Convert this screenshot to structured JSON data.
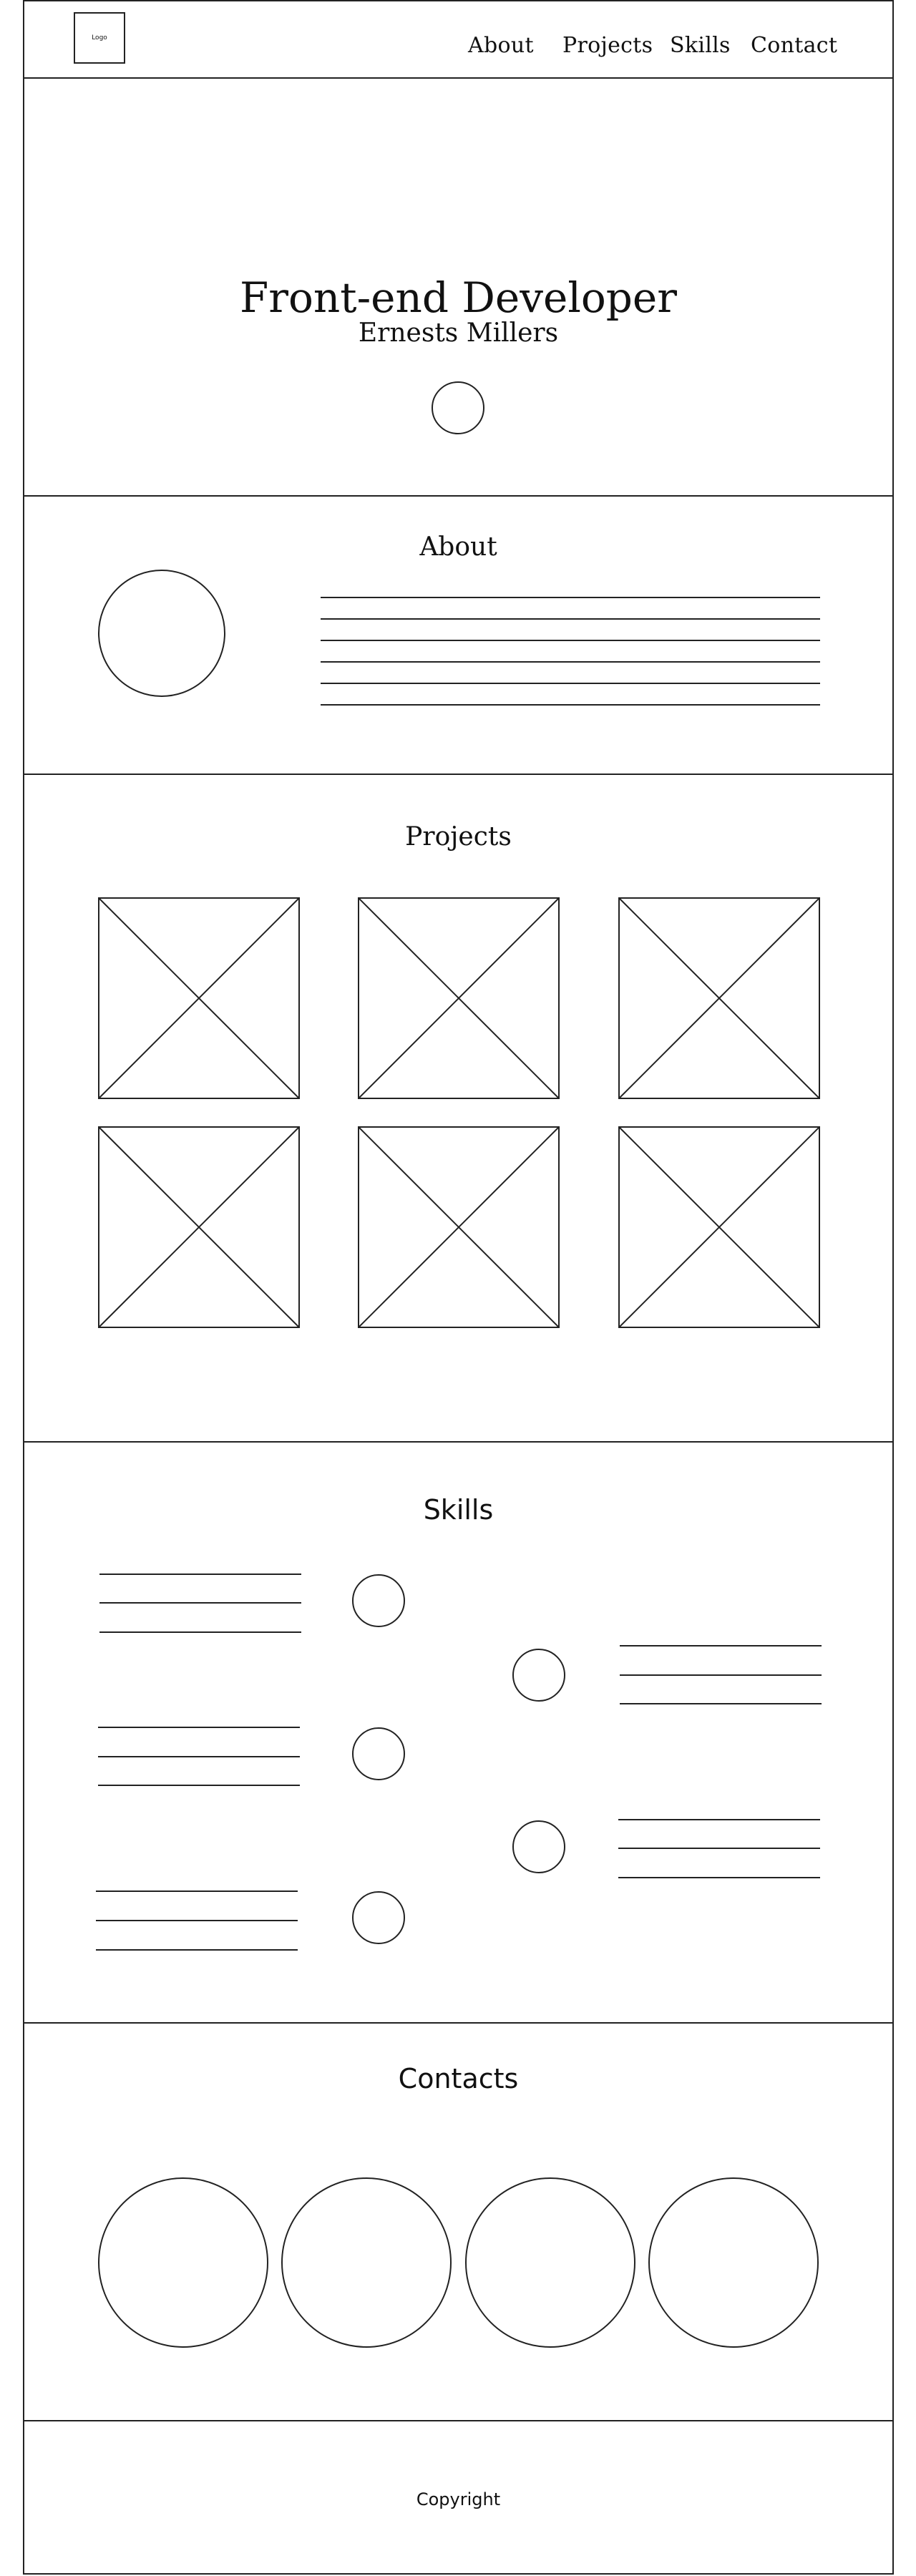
{
  "header": {
    "logo_label": "Logo",
    "nav": [
      {
        "label": "About"
      },
      {
        "label": "Projects"
      },
      {
        "label": "Skills"
      },
      {
        "label": "Contact"
      }
    ]
  },
  "hero": {
    "title": "Front-end Developer",
    "subtitle": "Ernests Millers"
  },
  "about": {
    "heading": "About"
  },
  "projects": {
    "heading": "Projects"
  },
  "skills": {
    "heading": "Skills"
  },
  "contacts": {
    "heading": "Contacts"
  },
  "footer": {
    "copyright": "Copyright"
  }
}
